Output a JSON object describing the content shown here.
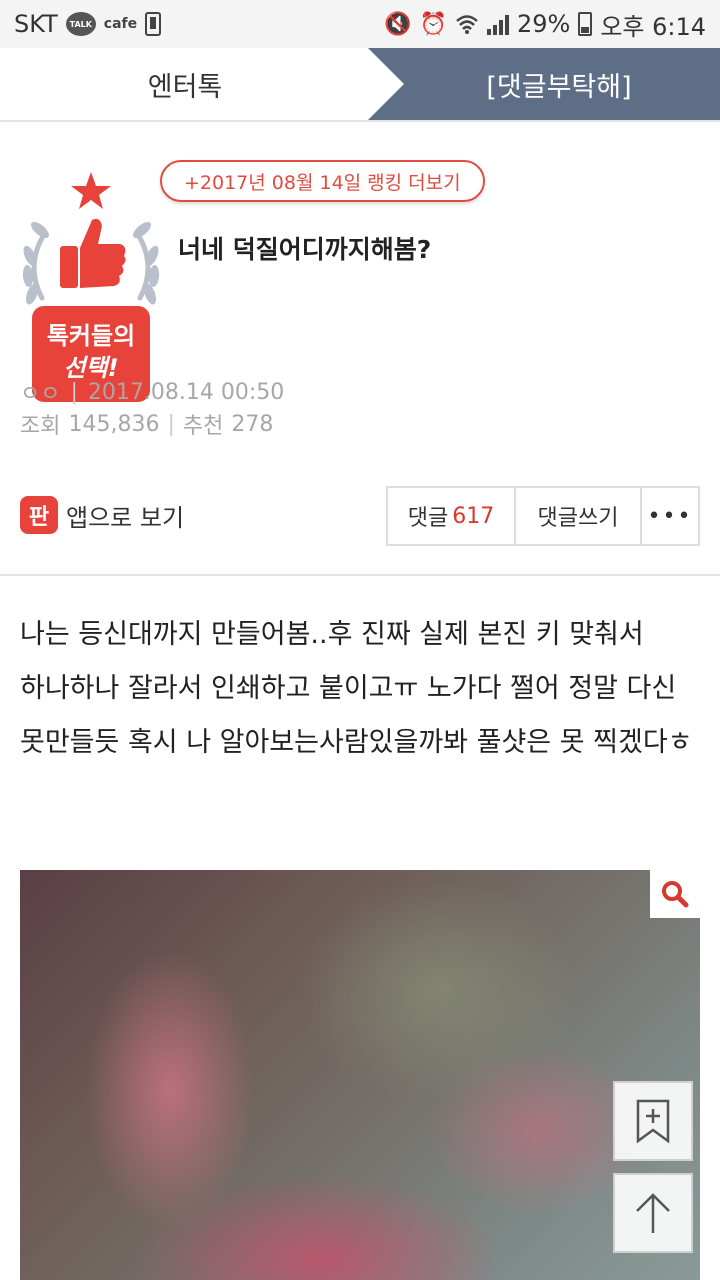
{
  "status_bar": {
    "carrier": "SKT",
    "talk_badge": "TALK",
    "cafe": "cafe",
    "battery_percent": "29%",
    "time": "오후 6:14",
    "icons": [
      "mute-icon",
      "alarm-icon",
      "wifi-icon",
      "signal-icon",
      "battery-icon"
    ]
  },
  "tabs": {
    "left": "엔터톡",
    "right": "[댓글부탁해]"
  },
  "post": {
    "badge_text_line1": "톡커들의",
    "badge_text_line2": "선택!",
    "ranking_link": "+2017년 08월 14일 랭킹 더보기",
    "title": "너네 덕질어디까지해봄?",
    "author": "ㅇㅇ",
    "date": "2017.08.14 00:50",
    "views_label": "조회",
    "views": "145,836",
    "recommend_label": "추천",
    "recommends": "278",
    "app_view_label": "앱으로 보기",
    "app_icon_glyph": "판",
    "comments_label": "댓글",
    "comments_count": "617",
    "write_comment_label": "댓글쓰기",
    "more_label": "•••",
    "body": "나는 등신대까지 만들어봄..후 진짜 실제 본진 키 맞춰서 하나하나 잘라서 인쇄하고 붙이고ㅠ 노가다 쩔어 정말 다신 못만들듯 혹시 나 알아보는사람있을까봐 풀샷은 못 찍겠다ㅎ"
  },
  "colors": {
    "accent_red": "#e24b3f",
    "tab_active_bg": "#5d6e86",
    "meta_gray": "#a7a7a7"
  }
}
